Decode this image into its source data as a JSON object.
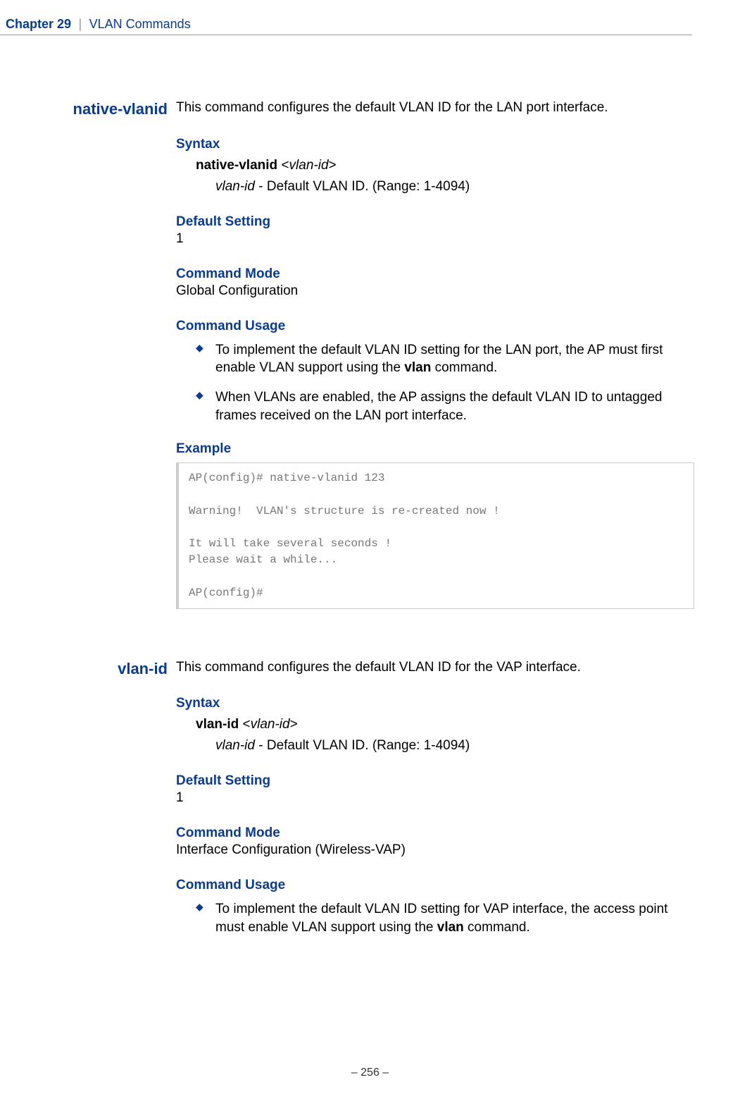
{
  "header": {
    "chapter_label": "Chapter 29",
    "chapter_title": "VLAN Commands"
  },
  "commands": [
    {
      "name": "native-vlanid",
      "intro": "This command configures the default VLAN ID for the LAN port interface.",
      "syntax_heading": "Syntax",
      "syntax_cmd": "native-vlanid",
      "syntax_arg_bracket_open": "<",
      "syntax_arg": "vlan-id",
      "syntax_arg_bracket_close": ">",
      "param_name": "vlan-id",
      "param_desc": " - Default VLAN ID. (Range: 1-4094)",
      "default_heading": "Default Setting",
      "default_value": "1",
      "mode_heading": "Command Mode",
      "mode_value": "Global Configuration",
      "usage_heading": "Command Usage",
      "usage_items": [
        {
          "pre": "To implement the default VLAN ID setting for the LAN port, the AP must first enable VLAN support using the ",
          "bold": "vlan",
          "post": " command."
        },
        {
          "pre": "When VLANs are enabled, the AP assigns the default VLAN ID to untagged frames received on the LAN port interface.",
          "bold": "",
          "post": ""
        }
      ],
      "example_heading": "Example",
      "example_code": "AP(config)# native-vlanid 123\n\nWarning!  VLAN's structure is re-created now !\n\nIt will take several seconds !\nPlease wait a while...\n\nAP(config)#"
    },
    {
      "name": "vlan-id",
      "intro": "This command configures the default VLAN ID for the VAP interface.",
      "syntax_heading": "Syntax",
      "syntax_cmd": "vlan-id",
      "syntax_arg_bracket_open": "<",
      "syntax_arg": "vlan-id",
      "syntax_arg_bracket_close": ">",
      "param_name": "vlan-id",
      "param_desc": " - Default VLAN ID. (Range: 1-4094)",
      "default_heading": "Default Setting",
      "default_value": "1",
      "mode_heading": "Command Mode",
      "mode_value": "Interface Configuration (Wireless-VAP)",
      "usage_heading": "Command Usage",
      "usage_items": [
        {
          "pre": "To implement the default VLAN ID setting for VAP interface, the access point must enable VLAN support using the ",
          "bold": "vlan",
          "post": " command."
        }
      ]
    }
  ],
  "footer": "–  256  –"
}
